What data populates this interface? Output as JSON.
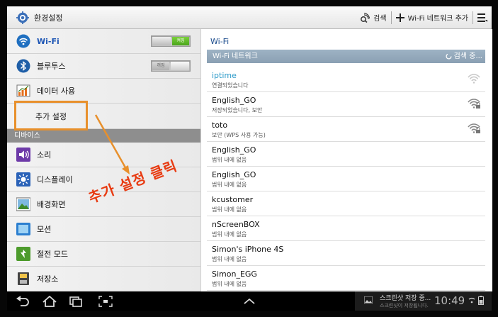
{
  "window": {
    "title": "환경설정"
  },
  "actionbar": {
    "search_label": "검색",
    "add_wifi_label": "Wi-Fi 네트워크 추가"
  },
  "left": {
    "wifi_label": "Wi-Fi",
    "wifi_toggle": "켜짐",
    "bluetooth_label": "블루투스",
    "bluetooth_toggle": "꺼짐",
    "data_usage_label": "데이터 사용",
    "more_settings_label": "추가 설정",
    "device_header": "디바이스",
    "sound_label": "소리",
    "display_label": "디스플레이",
    "wallpaper_label": "배경화면",
    "motion_label": "모션",
    "power_saving_label": "절전 모드",
    "storage_label": "저장소"
  },
  "right": {
    "title": "Wi-Fi",
    "networks_header": "Wi-Fi 네트워크",
    "scan_label": "검색 중...",
    "networks": [
      {
        "name": "iptime",
        "status": "연결되었습니다"
      },
      {
        "name": "English_GO",
        "status": "저장되었습니다, 보안"
      },
      {
        "name": "toto",
        "status": "보안 (WPS 사용 가능)"
      },
      {
        "name": "English_GO",
        "status": "범위 내에 없음"
      },
      {
        "name": "English_GO",
        "status": "범위 내에 없음"
      },
      {
        "name": "kcustomer",
        "status": "범위 내에 없음"
      },
      {
        "name": "nScreenBOX",
        "status": "범위 내에 없음"
      },
      {
        "name": "Simon's iPhone 4S",
        "status": "범위 내에 없음"
      },
      {
        "name": "Simon_EGG",
        "status": "범위 내에 없음"
      }
    ]
  },
  "annotation": {
    "text": "추가 설정 클릭"
  },
  "notification": {
    "title": "스크린샷 저장 중...",
    "subtitle": "스크린샷이 저장됩니다.",
    "time": "10:49"
  },
  "colors": {
    "accent_blue": "#1f57b5",
    "connected_blue": "#2b9ac9",
    "highlight_orange": "#e8902c",
    "annotation_red": "#e83b12",
    "header_steel": "#8aa0b3"
  }
}
